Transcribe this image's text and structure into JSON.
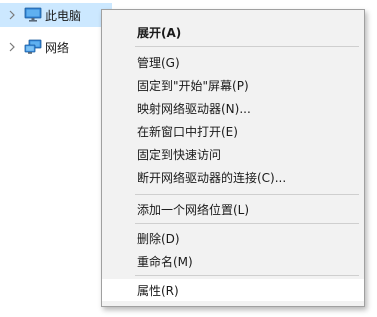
{
  "tree": {
    "items": [
      {
        "label": "此电脑",
        "icon": "computer-icon",
        "selected": true
      },
      {
        "label": "网络",
        "icon": "network-icon",
        "selected": false
      }
    ]
  },
  "context_menu": {
    "items": [
      {
        "label": "展开(A)",
        "bold": true
      },
      {
        "label": "管理(G)"
      },
      {
        "label": "固定到\"开始\"屏幕(P)"
      },
      {
        "label": "映射网络驱动器(N)..."
      },
      {
        "label": "在新窗口中打开(E)"
      },
      {
        "label": "固定到快速访问"
      },
      {
        "label": "断开网络驱动器的连接(C)..."
      },
      {
        "label": "添加一个网络位置(L)"
      },
      {
        "label": "删除(D)"
      },
      {
        "label": "重命名(M)"
      },
      {
        "label": "属性(R)",
        "highlighted": true
      }
    ]
  },
  "colors": {
    "selection": "#cce8ff",
    "menu_background": "#f2f2f2",
    "menu_hover": "#ffffff"
  }
}
